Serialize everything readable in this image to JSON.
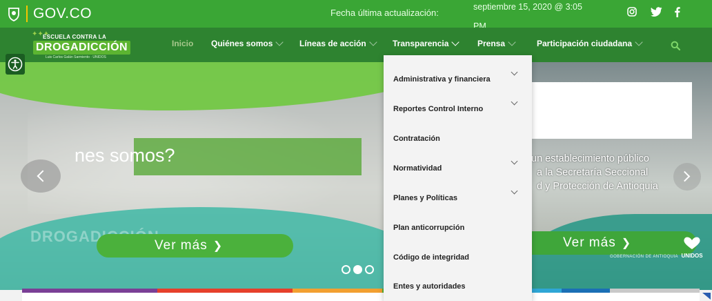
{
  "gov_bar": {
    "logo_text": "GOV.CO",
    "date_label": "Fecha última actualización:",
    "date_value": "septiembre 15, 2020 @ 3:05 PM",
    "social": [
      "instagram-icon",
      "twitter-icon",
      "facebook-icon"
    ]
  },
  "brand": {
    "line1": "ESCUELA CONTRA LA",
    "line2": "DROGADICCIÓN",
    "line3": "Luis Carlos Galán Sarmiento · UNIDOS"
  },
  "nav": {
    "items": [
      {
        "label": "Inicio"
      },
      {
        "label": "Quiénes somos"
      },
      {
        "label": "Líneas de acción"
      },
      {
        "label": "Transparencia"
      },
      {
        "label": "Prensa"
      },
      {
        "label": "Participación ciudadana"
      }
    ]
  },
  "dropdown": {
    "items": [
      {
        "label": "Administrativa y financiera",
        "has_submenu": true
      },
      {
        "label": "Reportes Control Interno",
        "has_submenu": true
      },
      {
        "label": "Contratación",
        "has_submenu": false
      },
      {
        "label": "Normatividad",
        "has_submenu": true
      },
      {
        "label": "Planes y Políticas",
        "has_submenu": true
      },
      {
        "label": "Plan anticorrupción",
        "has_submenu": false
      },
      {
        "label": "Código de integridad",
        "has_submenu": false
      },
      {
        "label": "Entes y autoridades",
        "has_submenu": false
      }
    ]
  },
  "hero": {
    "headline": "nes somos?",
    "description": "un establecimiento público\n  a la Secretaría Seccional\n  d y Protección de Antioquia",
    "button_left": "Ver más",
    "button_right": "Ver más",
    "watermark": "DROGADICCIÓN",
    "gobernacion": "GOBERNACIÓN DE ANTIOQUIA",
    "unidos": "UNIDOS",
    "active_slide": 2,
    "slide_count": 3
  },
  "colors": {
    "gov_green": "#3aa635",
    "nav_green": "#2e8330",
    "strip": [
      "#7a3f96",
      "#e6402b",
      "#f2a031",
      "#5cb531",
      "#2fa6d6",
      "#1b6fb5",
      "#c9c9c9"
    ]
  }
}
